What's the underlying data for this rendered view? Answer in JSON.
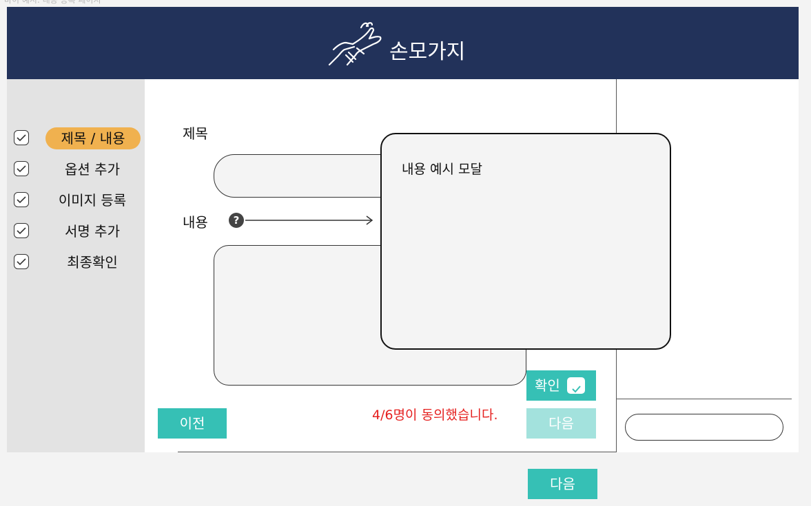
{
  "caption": "바이 예시. 내용 등록 페이지",
  "brand": {
    "name": "손모가지",
    "logo_icon": "hands-holding-icon"
  },
  "steps": [
    {
      "label": "제목 / 내용",
      "active": true,
      "icon": "check-icon"
    },
    {
      "label": "옵션 추가",
      "active": false,
      "icon": "check-icon"
    },
    {
      "label": "이미지 등록",
      "active": false,
      "icon": "check-icon"
    },
    {
      "label": "서명 추가",
      "active": false,
      "icon": "check-icon"
    },
    {
      "label": "최종확인",
      "active": false,
      "icon": "check-icon"
    }
  ],
  "form": {
    "title_label": "제목",
    "content_label": "내용",
    "help_icon": "?",
    "title_value": "",
    "content_value": ""
  },
  "modal": {
    "title": "내용 예시 모달"
  },
  "buttons": {
    "prev": "이전",
    "confirm": "확인",
    "next_disabled": "다음",
    "next": "다음"
  },
  "consent_status": "4/6명이 동의했습니다.",
  "colors": {
    "header": "#22325a",
    "accent": "#36c0b5",
    "accent_disabled": "#a3e2dd",
    "active_step": "#f0b14f",
    "alert": "#e5201f"
  }
}
